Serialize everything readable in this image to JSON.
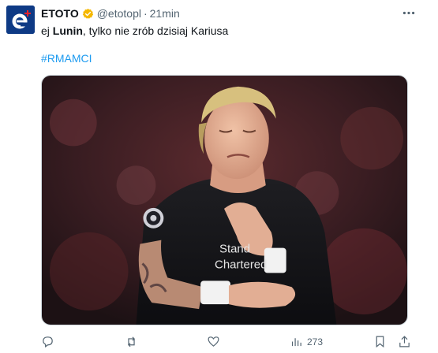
{
  "post": {
    "author_name": "ETOTO",
    "handle": "@etotopl",
    "separator": "·",
    "time": "21min",
    "text_prefix": "ej ",
    "text_bold": "Lunin",
    "text_rest": ", tylko nie zrób dzisiaj Kariusa",
    "hashtag": "#RMAMCI",
    "media_lettering": [
      "Stand",
      "Chartered"
    ],
    "verified_badge_color": "#f5b800",
    "link_color": "#1d9bf0"
  },
  "actions": {
    "reply_icon": "reply-icon",
    "repost_icon": "repost-icon",
    "like_icon": "like-icon",
    "views_icon": "views-icon",
    "views_count": "273",
    "bookmark_icon": "bookmark-icon",
    "share_icon": "share-icon"
  }
}
